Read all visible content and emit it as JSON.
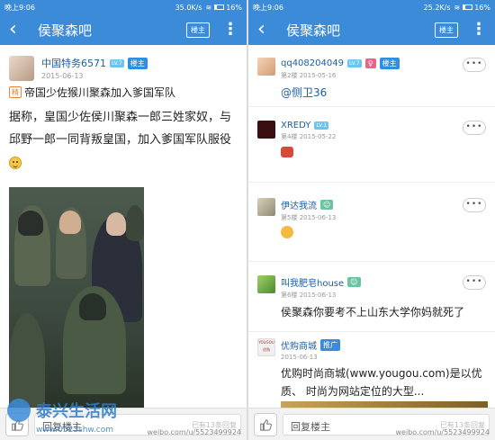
{
  "left": {
    "status": {
      "time": "晚上9:06",
      "net": "35.0K/s",
      "battery": "16%",
      "battery_level": 0.16
    },
    "nav": {
      "back": "‹",
      "title": "侯聚森吧",
      "owner_label": "楼主",
      "more": "⋮"
    },
    "post": {
      "author": "中国特务6571",
      "level": "LV.7",
      "role_badge": "楼主",
      "date": "2015-06-13",
      "jing_badge": "精",
      "title": "帝国少佐猴川聚森加入爹国军队",
      "body": "据称，皇国少佐侯川聚森一郎三姓家奴，与邱野一郎一同背叛皇国，加入爹国军队服役"
    },
    "bottom": {
      "reply_placeholder": "回复楼主",
      "partial_text": "已有13条回复"
    }
  },
  "right": {
    "status": {
      "time": "晚上9:06",
      "net": "25.2K/s",
      "battery": "16%",
      "battery_level": 0.16
    },
    "nav": {
      "back": "‹",
      "title": "侯聚森吧",
      "owner_label": "楼主",
      "more": "⋮"
    },
    "replies": [
      {
        "user": "qq408204049",
        "level": "LV.7",
        "gender": "♀",
        "badge": "楼主",
        "floor": "第2楼",
        "date": "2015-05-16",
        "text": "@侧卫36"
      },
      {
        "user": "XREDY",
        "level": "LV.1",
        "floor": "第4楼",
        "date": "2015-05-22",
        "text": ""
      },
      {
        "user": "伊达我流",
        "floor": "第5楼",
        "date": "2015-06-13",
        "text": ""
      },
      {
        "user": "叫我肥皂house",
        "floor": "第6楼",
        "date": "2015-06-13",
        "text": "侯聚森你要考不上山东大学你妈就死了"
      },
      {
        "user": "优购商城",
        "badge": "推广",
        "avatar_text": "YOUGOU 优购",
        "date": "2015-06-13",
        "text": "优购时尚商城(www.yougou.com)是以优质、 时尚为网站定位的大型..."
      }
    ],
    "more_label": "•••",
    "bottom": {
      "reply_placeholder": "回复楼主",
      "partial_text": "已有13条回复"
    }
  },
  "watermark": {
    "site": "泰兴生活网",
    "url": "www.0523shw.com",
    "weibo": "weibo.com/u/5523499924"
  },
  "colors": {
    "accent": "#3b8bd8",
    "link": "#1c5fa3"
  }
}
